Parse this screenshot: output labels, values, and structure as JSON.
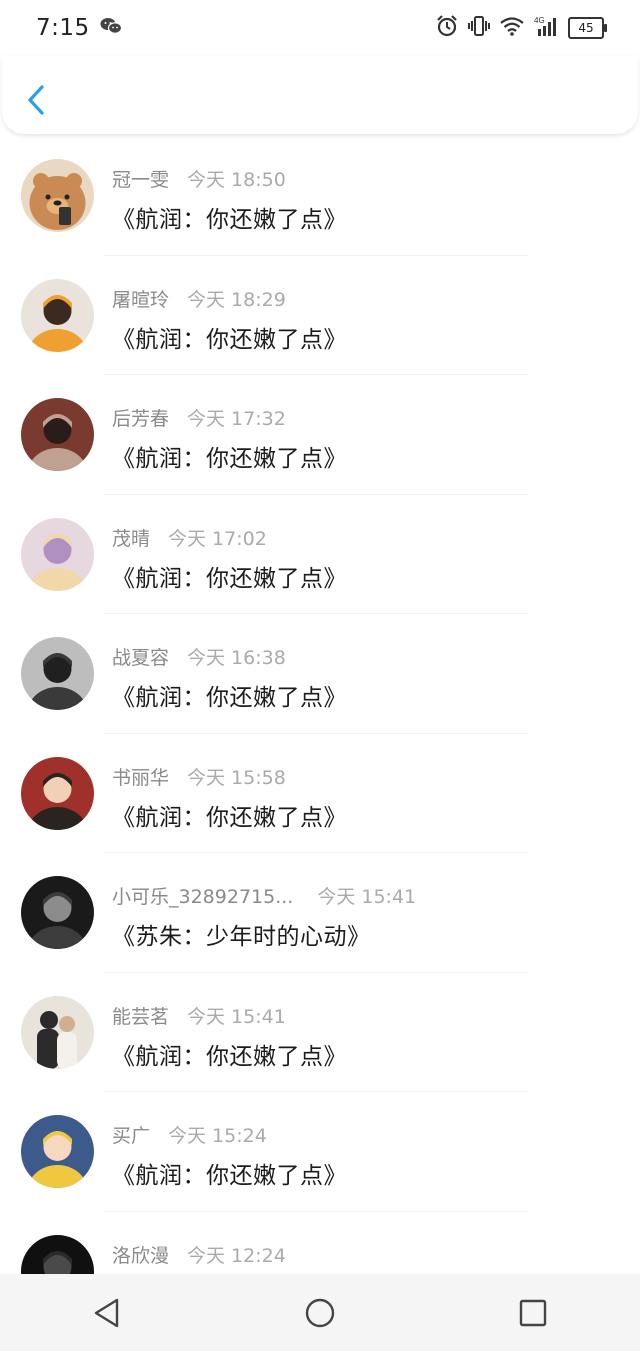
{
  "status_bar": {
    "time": "7:15",
    "battery": "45"
  },
  "entries": [
    {
      "name": "冠一雯",
      "time": "今天 18:50",
      "book": "《航润：你还嫩了点》",
      "gap": 18
    },
    {
      "name": "屠暄玲",
      "time": "今天 18:29",
      "book": "《航润：你还嫩了点》",
      "gap": 18
    },
    {
      "name": "后芳春",
      "time": "今天 17:32",
      "book": "《航润：你还嫩了点》",
      "gap": 18
    },
    {
      "name": "茂晴",
      "time": "今天 17:02",
      "book": "《航润：你还嫩了点》",
      "gap": 18
    },
    {
      "name": "战夏容",
      "time": "今天 16:38",
      "book": "《航润：你还嫩了点》",
      "gap": 18
    },
    {
      "name": "书丽华",
      "time": "今天 15:58",
      "book": "《航润：你还嫩了点》",
      "gap": 18
    },
    {
      "name": "小可乐_32892715...",
      "time": "今天 15:41",
      "book": "《苏朱：少年时的心动》",
      "gap": 24
    },
    {
      "name": "能芸茗",
      "time": "今天 15:41",
      "book": "《航润：你还嫩了点》",
      "gap": 18
    },
    {
      "name": "买广",
      "time": "今天 15:24",
      "book": "《航润：你还嫩了点》",
      "gap": 18
    },
    {
      "name": "洛欣漫",
      "time": "今天 12:24",
      "book": "",
      "gap": 18
    }
  ],
  "colors": {
    "accent": "#2a9fe6",
    "name": "#8a8a8a",
    "time": "#aaaaaa",
    "book": "#1c1c1c"
  }
}
